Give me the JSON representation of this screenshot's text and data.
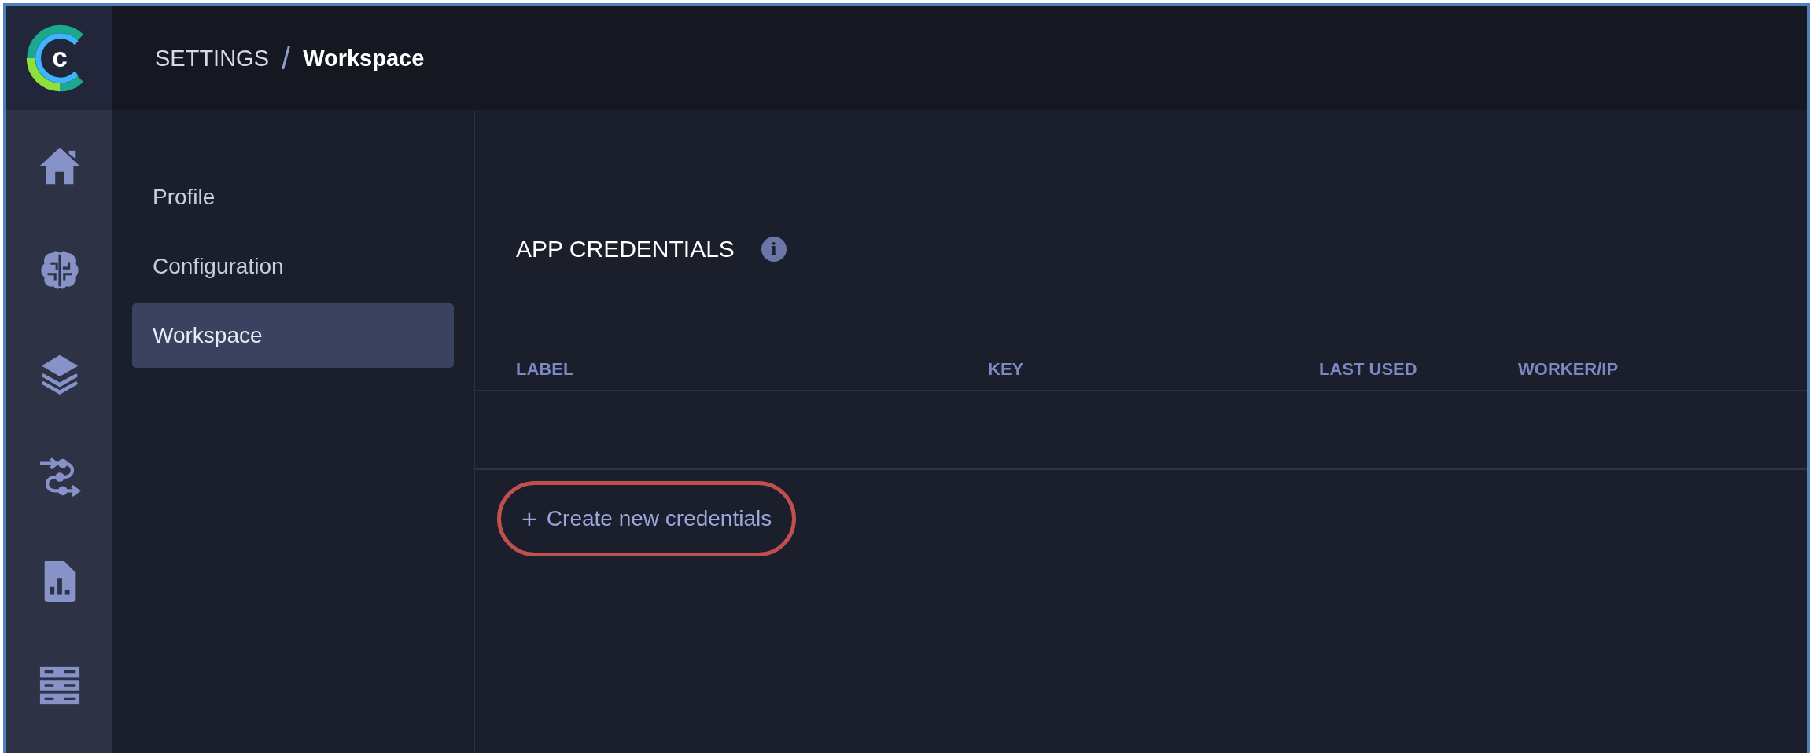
{
  "logo": {
    "letter": "c"
  },
  "breadcrumb": {
    "section": "SETTINGS",
    "separator": "/",
    "page": "Workspace"
  },
  "rail": [
    {
      "kind": "home"
    },
    {
      "kind": "brain"
    },
    {
      "kind": "layers"
    },
    {
      "kind": "flow"
    },
    {
      "kind": "report"
    },
    {
      "kind": "server"
    }
  ],
  "settings_nav": [
    {
      "label": "Profile",
      "selected": false
    },
    {
      "label": "Configuration",
      "selected": false
    },
    {
      "label": "Workspace",
      "selected": true
    }
  ],
  "app_credentials": {
    "title": "APP CREDENTIALS",
    "info_icon": "i",
    "table": {
      "columns": [
        "LABEL",
        "KEY",
        "LAST USED",
        "WORKER/IP"
      ]
    },
    "create_button": {
      "icon": "+",
      "label": "Create new credentials",
      "annotated": true
    }
  }
}
